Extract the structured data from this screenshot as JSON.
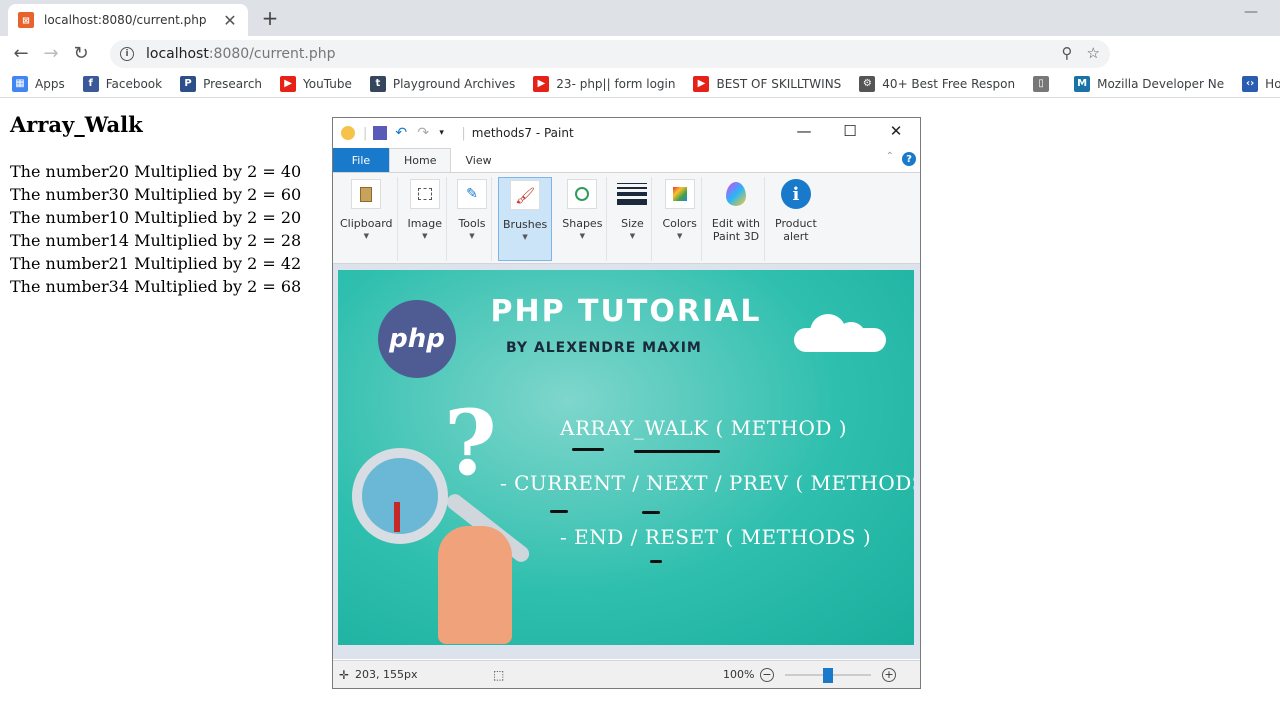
{
  "browser": {
    "tab_title": "localhost:8080/current.php",
    "url_host": "localhost",
    "url_path": ":8080/current.php",
    "bookmarks": [
      {
        "label": "Apps",
        "icon": "apps-grid-icon",
        "color": "#4285f4"
      },
      {
        "label": "Facebook",
        "icon": "facebook-icon",
        "color": "#3b5998"
      },
      {
        "label": "Presearch",
        "icon": "presearch-icon",
        "color": "#2c4e8a"
      },
      {
        "label": "YouTube",
        "icon": "youtube-icon",
        "color": "#e62117"
      },
      {
        "label": "Playground Archives",
        "icon": "tumblr-icon",
        "color": "#36465d"
      },
      {
        "label": "23- php|| form login",
        "icon": "youtube-icon",
        "color": "#e62117"
      },
      {
        "label": "BEST OF SKILLTWINS",
        "icon": "youtube-icon",
        "color": "#e62117"
      },
      {
        "label": "40+ Best Free Respon",
        "icon": "gear-icon",
        "color": "#555555"
      },
      {
        "label": "",
        "icon": "document-icon",
        "color": "#777777"
      },
      {
        "label": "Mozilla Developer Ne",
        "icon": "mozilla-icon",
        "color": "#1a73a8"
      },
      {
        "label": "Home of free code s",
        "icon": "code-icon",
        "color": "#2a5db0"
      }
    ]
  },
  "page": {
    "title": "Array_Walk",
    "results": [
      "The number20 Multiplied by 2 = 40",
      "The number30 Multiplied by 2 = 60",
      "The number10 Multiplied by 2 = 20",
      "The number14 Multiplied by 2 = 28",
      "The number21 Multiplied by 2 = 42",
      "The number34 Multiplied by 2 = 68"
    ]
  },
  "paint": {
    "window_title": "methods7 - Paint",
    "tabs": {
      "file": "File",
      "home": "Home",
      "view": "View"
    },
    "tools": {
      "clipboard": "Clipboard",
      "image": "Image",
      "tools": "Tools",
      "brushes": "Brushes",
      "shapes": "Shapes",
      "size": "Size",
      "colors": "Colors",
      "paint3d_line1": "Edit with",
      "paint3d_line2": "Paint 3D",
      "alert_line1": "Product",
      "alert_line2": "alert"
    },
    "image": {
      "logo_text": "php",
      "title": "PHP TUTORIAL",
      "subtitle": "BY ALEXENDRE MAXIM",
      "line1": "ARRAY_WALK ( METHOD )",
      "line2": "- CURRENT / NEXT / PREV ( METHODS )",
      "line3": "- END / RESET ( METHODS )",
      "question_mark": "?"
    },
    "status": {
      "cursor_position": "203, 155px",
      "zoom": "100%"
    }
  }
}
